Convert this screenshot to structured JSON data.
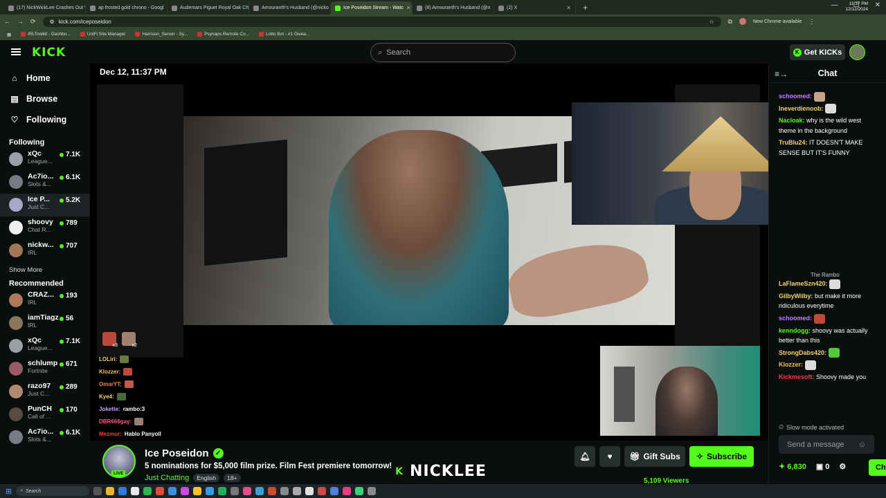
{
  "browser": {
    "tabs": [
      {
        "title": "(17) NickWickLee Crashes Out W",
        "active": false
      },
      {
        "title": "ap frosted gold chrono - Googl",
        "active": false
      },
      {
        "title": "Audemars Piguet Royal Oak Ch",
        "active": false
      },
      {
        "title": "Amouranth's Husband (@nicko",
        "active": false
      },
      {
        "title": "Ice Poseidon Stream - Watc",
        "active": true
      },
      {
        "title": "(8) Amouranth's Husband (@n",
        "active": false
      },
      {
        "title": "(2) X",
        "active": false
      }
    ],
    "url": "kick.com/iceposeidon",
    "new_chrome": "New Chrome available",
    "bookmarks": [
      "IRLToolkit - Dashbo...",
      "UniFi Site Manager",
      "Harrison_Server - Sy...",
      "Psynaps Remote Co...",
      "Lotto Bot - #1 Givea..."
    ]
  },
  "header": {
    "logo": "KICK",
    "search_placeholder": "Search",
    "get_kicks": "Get KICKs"
  },
  "sidebar": {
    "nav": [
      {
        "label": "Home",
        "icon": "home-icon"
      },
      {
        "label": "Browse",
        "icon": "browse-icon"
      },
      {
        "label": "Following",
        "icon": "heart-icon"
      }
    ],
    "following_title": "Following",
    "following": [
      {
        "name": "xQc",
        "category": "League...",
        "viewers": "7.1K",
        "color": "#9aa0a6"
      },
      {
        "name": "Ac7io...",
        "category": "Slots &...",
        "viewers": "6.1K",
        "color": "#777b85"
      },
      {
        "name": "Ice P...",
        "category": "Just C...",
        "viewers": "5.2K",
        "color": "#a8a8c8"
      },
      {
        "name": "shoovy",
        "category": "Chat R...",
        "viewers": "789",
        "color": "#f0f0f0"
      },
      {
        "name": "nickw...",
        "category": "IRL",
        "viewers": "707",
        "color": "#a07858"
      }
    ],
    "show_more": "Show More",
    "recommended_title": "Recommended",
    "recommended": [
      {
        "name": "CRAZ...",
        "category": "IRL",
        "viewers": "193",
        "color": "#b07a5a"
      },
      {
        "name": "iamTiagz",
        "category": "IRL",
        "viewers": "56",
        "color": "#8a7658"
      },
      {
        "name": "xQc",
        "category": "League...",
        "viewers": "7.1K",
        "color": "#9aa0a6"
      },
      {
        "name": "schlump",
        "category": "Fortnite",
        "viewers": "671",
        "color": "#9a5a6a"
      },
      {
        "name": "razo97",
        "category": "Just C...",
        "viewers": "289",
        "color": "#b08a70"
      },
      {
        "name": "PunCH",
        "category": "Call of ...",
        "viewers": "170",
        "color": "#5a4a40"
      },
      {
        "name": "Ac7io...",
        "category": "Slots &...",
        "viewers": "6.1K",
        "color": "#777b85"
      }
    ]
  },
  "stream": {
    "timestamp": "Dec 12, 11:37 PM",
    "emote_counts": [
      "x3",
      "x2"
    ],
    "overlay_chat": [
      {
        "user": "LOLiri:",
        "text": "",
        "color": "#f5d36a"
      },
      {
        "user": "Klozzer:",
        "text": "",
        "color": "#f5c242"
      },
      {
        "user": "OmarYT:",
        "text": "",
        "color": "#f07f4f"
      },
      {
        "user": "Kye4:",
        "text": "",
        "color": "#f5d36a"
      },
      {
        "user": "Jokette:",
        "text": "rambo:3",
        "color": "#c8a2ff"
      },
      {
        "user": "DBR666gay:",
        "text": "",
        "color": "#ff5a7a"
      },
      {
        "user": "Mezmur:",
        "text": "Hablo Panyoll",
        "color": "#ff3b3b"
      }
    ]
  },
  "info": {
    "streamer": "Ice Poseidon",
    "live_badge": "LIVE",
    "title": "5 nominations for $5,000 film prize. Film Fest premiere tomorrow!",
    "category": "Just Chatting",
    "tags": [
      "English",
      "18+"
    ],
    "watermark": "NICKLEE",
    "viewers": "5,109 Viewers",
    "gift_subs": "Gift Subs",
    "subscribe": "Subscribe"
  },
  "chat": {
    "title": "Chat",
    "messages": [
      {
        "user": "schoomed:",
        "text": "",
        "color": "#c57cff",
        "emote": "#c7a28a"
      },
      {
        "user": "Ineverdienoob:",
        "text": "",
        "color": "#f5d36a",
        "emote": "#dcdcdc"
      },
      {
        "user": "Nacloak:",
        "text": "why is the wild west theme in the background",
        "color": "#53fc18",
        "emote": ""
      },
      {
        "user": "TruBlu24:",
        "text": "IT DOESN'T MAKE SENSE BUT IT'S FUNNY",
        "color": "#f5d36a",
        "emote": ""
      },
      {
        "user": "LaFlameSzn420:",
        "text": "",
        "color": "#f5d36a",
        "emote": "#dcdcdc"
      },
      {
        "user": "GilbyWilby:",
        "text": "but make it more ridiculous everytime",
        "color": "#f5d36a",
        "emote": ""
      },
      {
        "user": "schoomed:",
        "text": "",
        "color": "#c57cff",
        "emote": "#c04a3a"
      },
      {
        "user": "kenndogg:",
        "text": "shoovy was actually better than this",
        "color": "#53fc18",
        "emote": ""
      },
      {
        "user": "StrongDabs420:",
        "text": "",
        "color": "#f5d36a",
        "emote": "#53c83a"
      },
      {
        "user": "Klozzer:",
        "text": "",
        "color": "#f5c242",
        "emote": "#dcdcdc"
      },
      {
        "user": "Kickmesoft:",
        "text": "Shoovy made you",
        "color": "#ff3b3b",
        "emote": ""
      }
    ],
    "partial_line": "The Rambo",
    "slow_mode": "Slow mode activated",
    "send_placeholder": "Send a message",
    "points": "6,830",
    "boxes": "0",
    "chat_button": "Chat"
  },
  "taskbar": {
    "search": "Search",
    "time": "11:37 PM",
    "date": "12/12/2024"
  },
  "accent": "#53fc18"
}
